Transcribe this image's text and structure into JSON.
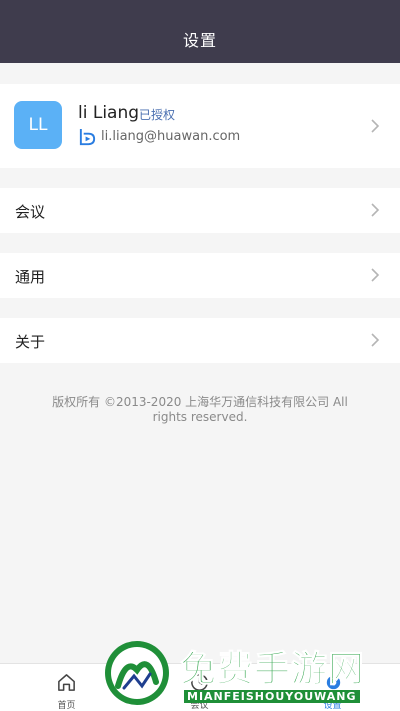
{
  "header": {
    "title": "设置"
  },
  "profile": {
    "avatar_initials": "LL",
    "name": "li Liang",
    "badge": "已授权",
    "email": "li.liang@huawan.com",
    "brand_icon": "bilibili-style-b-icon"
  },
  "rows": [
    {
      "label": "会议"
    },
    {
      "label": "通用"
    },
    {
      "label": "关于"
    }
  ],
  "copyright": "版权所有 ©2013-2020 上海华万通信科技有限公司 All rights reserved.",
  "tabbar": {
    "tabs": [
      {
        "label": "首页",
        "icon": "home-icon"
      },
      {
        "label": "会议",
        "icon": "clock-icon"
      },
      {
        "label": "设置",
        "icon": "settings-icon",
        "active": true
      }
    ]
  },
  "watermark": {
    "title": "免费手游网",
    "subtitle": "MIANFEISHOUYOUWANG"
  },
  "colors": {
    "header_bg": "#3f3c4d",
    "avatar_bg": "#5bb1f6",
    "accent": "#2a7de1",
    "watermark_green": "#27a043"
  }
}
